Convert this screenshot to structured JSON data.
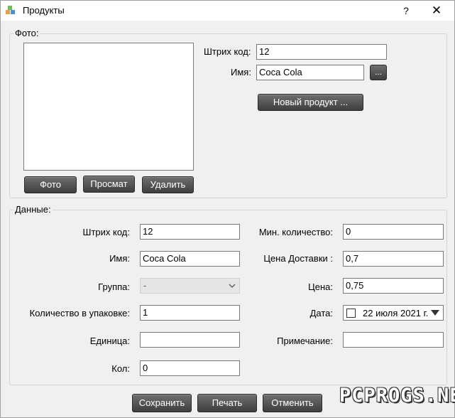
{
  "window": {
    "title": "Продукты",
    "help": "?",
    "close": "✕"
  },
  "photo_group": {
    "title": "Фото:",
    "buttons": {
      "photo": "Фото",
      "view": "Просмат",
      "delete": "Удалить"
    },
    "barcode_label": "Штрих код:",
    "barcode_value": "12",
    "name_label": "Имя:",
    "name_value": "Coca Cola",
    "browse_label": "...",
    "new_product_label": "Новый продукт ..."
  },
  "data_group": {
    "title": "Данные:",
    "barcode_label": "Штрих код:",
    "barcode_value": "12",
    "name_label": "Имя:",
    "name_value": "Coca Cola",
    "group_label": "Группа:",
    "group_value": "-",
    "pack_qty_label": "Количество в упаковке:",
    "pack_qty_value": "1",
    "unit_label": "Единица:",
    "unit_value": "",
    "qty_label": "Кол:",
    "qty_value": "0",
    "min_qty_label": "Мин. количество:",
    "min_qty_value": "0",
    "delivery_price_label": "Цена Доставки :",
    "delivery_price_value": "0,7",
    "price_label": "Цена:",
    "price_value": "0,75",
    "date_label": "Дата:",
    "date_value": "22 июля 2021 г.",
    "note_label": "Примечание:",
    "note_value": ""
  },
  "footer": {
    "save": "Сохранить",
    "print": "Печать",
    "cancel": "Отменить"
  },
  "watermark": "PCPROGS.NET"
}
